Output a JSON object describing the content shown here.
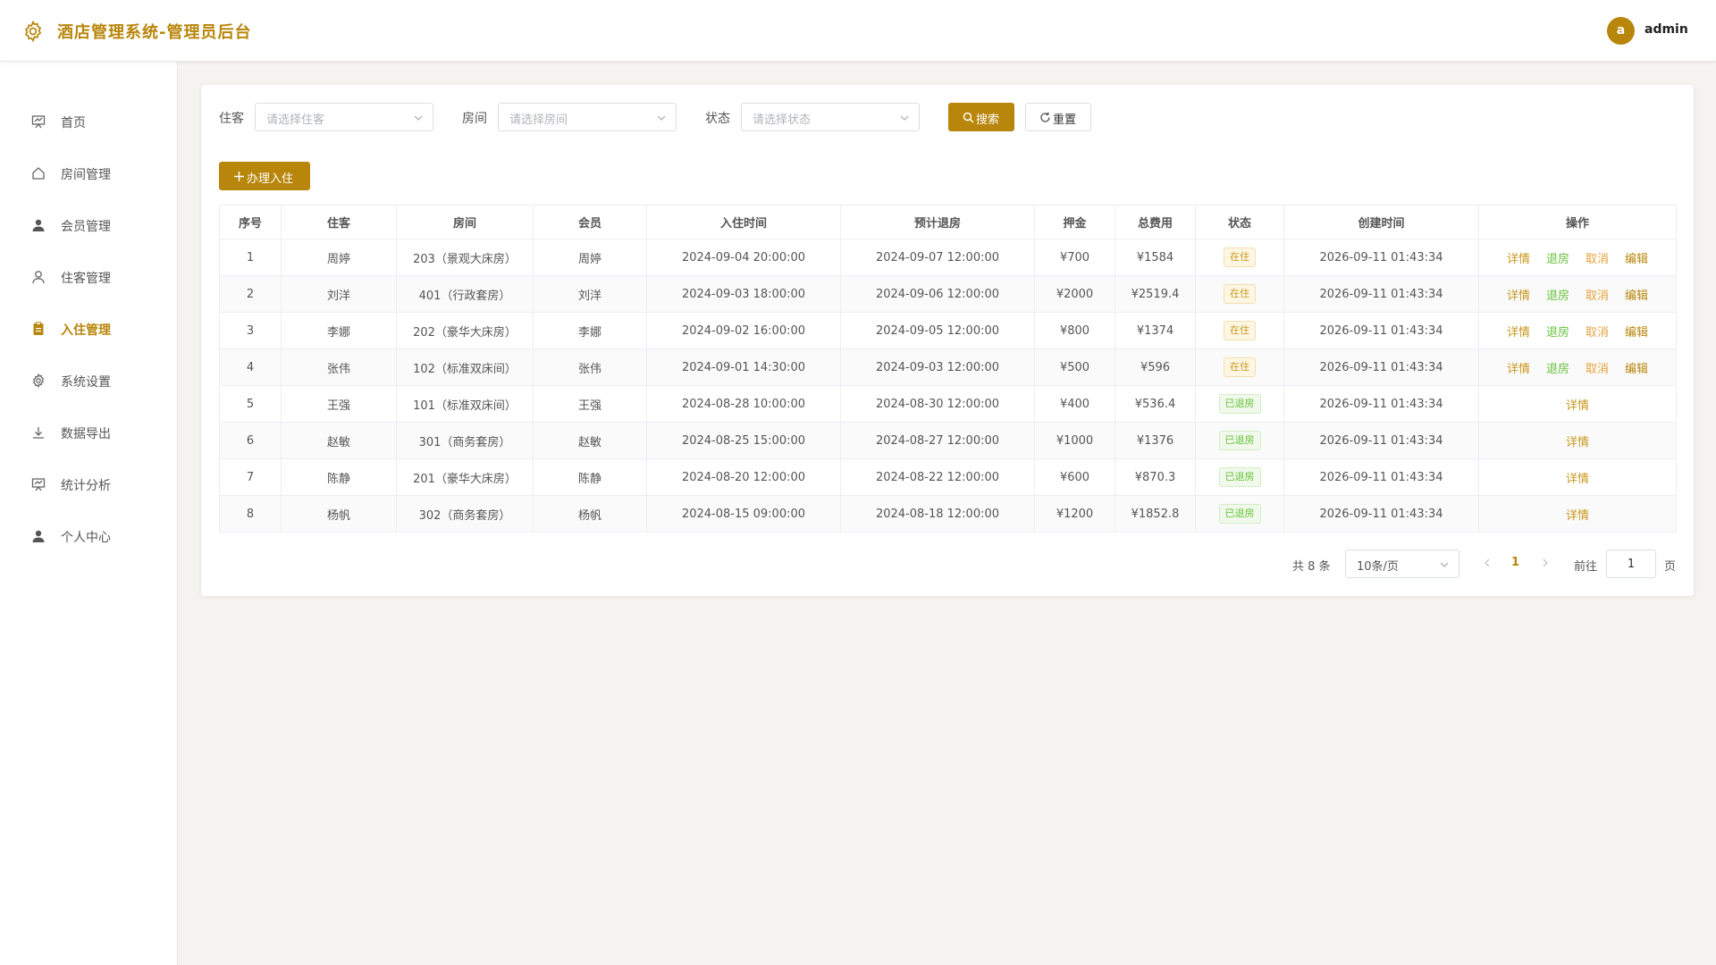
{
  "app": {
    "title": "酒店管理系统-管理员后台",
    "accent": "#b8860b"
  },
  "user": {
    "avatar_letter": "a",
    "name": "admin"
  },
  "sidebar": {
    "items": [
      {
        "label": "首页",
        "icon": "dashboard-icon",
        "active": false
      },
      {
        "label": "房间管理",
        "icon": "home-icon",
        "active": false
      },
      {
        "label": "会员管理",
        "icon": "member-icon",
        "active": false
      },
      {
        "label": "住客管理",
        "icon": "user-icon",
        "active": false
      },
      {
        "label": "入住管理",
        "icon": "clipboard-icon",
        "active": true
      },
      {
        "label": "系统设置",
        "icon": "gear-icon",
        "active": false
      },
      {
        "label": "数据导出",
        "icon": "download-icon",
        "active": false
      },
      {
        "label": "统计分析",
        "icon": "chart-icon",
        "active": false
      },
      {
        "label": "个人中心",
        "icon": "profile-icon",
        "active": false
      }
    ]
  },
  "filters": {
    "guest": {
      "label": "住客",
      "placeholder": "请选择住客"
    },
    "room": {
      "label": "房间",
      "placeholder": "请选择房间"
    },
    "status": {
      "label": "状态",
      "placeholder": "请选择状态"
    },
    "search_label": "搜索",
    "reset_label": "重置"
  },
  "add_button": {
    "label": "办理入住"
  },
  "table": {
    "columns": [
      "序号",
      "住客",
      "房间",
      "会员",
      "入住时间",
      "预计退房",
      "押金",
      "总费用",
      "状态",
      "创建时间",
      "操作"
    ],
    "rows": [
      {
        "no": "1",
        "guest": "周婷",
        "room": "203（景观大床房）",
        "member": "周婷",
        "checkin": "2024-09-04 20:00:00",
        "checkout": "2024-09-07 12:00:00",
        "deposit": "¥700",
        "total": "¥1584",
        "status": "在住",
        "created": "2026-09-11 01:43:34",
        "actions": [
          "详情",
          "退房",
          "取消",
          "编辑"
        ]
      },
      {
        "no": "2",
        "guest": "刘洋",
        "room": "401（行政套房）",
        "member": "刘洋",
        "checkin": "2024-09-03 18:00:00",
        "checkout": "2024-09-06 12:00:00",
        "deposit": "¥2000",
        "total": "¥2519.4",
        "status": "在住",
        "created": "2026-09-11 01:43:34",
        "actions": [
          "详情",
          "退房",
          "取消",
          "编辑"
        ]
      },
      {
        "no": "3",
        "guest": "李娜",
        "room": "202（豪华大床房）",
        "member": "李娜",
        "checkin": "2024-09-02 16:00:00",
        "checkout": "2024-09-05 12:00:00",
        "deposit": "¥800",
        "total": "¥1374",
        "status": "在住",
        "created": "2026-09-11 01:43:34",
        "actions": [
          "详情",
          "退房",
          "取消",
          "编辑"
        ]
      },
      {
        "no": "4",
        "guest": "张伟",
        "room": "102（标准双床间）",
        "member": "张伟",
        "checkin": "2024-09-01 14:30:00",
        "checkout": "2024-09-03 12:00:00",
        "deposit": "¥500",
        "total": "¥596",
        "status": "在住",
        "created": "2026-09-11 01:43:34",
        "actions": [
          "详情",
          "退房",
          "取消",
          "编辑"
        ]
      },
      {
        "no": "5",
        "guest": "王强",
        "room": "101（标准双床间）",
        "member": "王强",
        "checkin": "2024-08-28 10:00:00",
        "checkout": "2024-08-30 12:00:00",
        "deposit": "¥400",
        "total": "¥536.4",
        "status": "已退房",
        "created": "2026-09-11 01:43:34",
        "actions": [
          "详情"
        ]
      },
      {
        "no": "6",
        "guest": "赵敏",
        "room": "301（商务套房）",
        "member": "赵敏",
        "checkin": "2024-08-25 15:00:00",
        "checkout": "2024-08-27 12:00:00",
        "deposit": "¥1000",
        "total": "¥1376",
        "status": "已退房",
        "created": "2026-09-11 01:43:34",
        "actions": [
          "详情"
        ]
      },
      {
        "no": "7",
        "guest": "陈静",
        "room": "201（豪华大床房）",
        "member": "陈静",
        "checkin": "2024-08-20 12:00:00",
        "checkout": "2024-08-22 12:00:00",
        "deposit": "¥600",
        "total": "¥870.3",
        "status": "已退房",
        "created": "2026-09-11 01:43:34",
        "actions": [
          "详情"
        ]
      },
      {
        "no": "8",
        "guest": "杨帆",
        "room": "302（商务套房）",
        "member": "杨帆",
        "checkin": "2024-08-15 09:00:00",
        "checkout": "2024-08-18 12:00:00",
        "deposit": "¥1200",
        "total": "¥1852.8",
        "status": "已退房",
        "created": "2026-09-11 01:43:34",
        "actions": [
          "详情"
        ]
      }
    ]
  },
  "pagination": {
    "total_text": "共 8 条",
    "page_size": "10条/页",
    "current_page": "1",
    "goto_label": "前往",
    "goto_value": "1",
    "page_unit": "页"
  }
}
